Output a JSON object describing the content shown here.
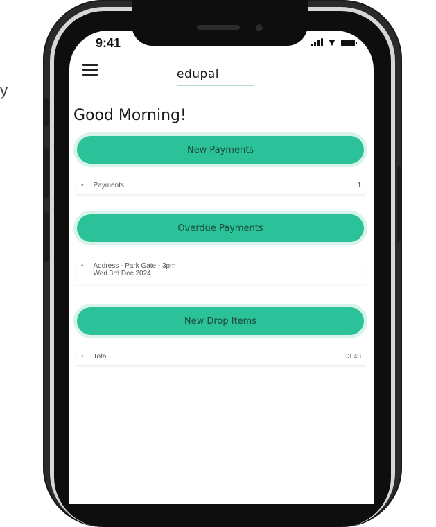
{
  "edge_fragment": "y",
  "status_bar": {
    "time": "9:41",
    "signal_icon": "signal-icon",
    "wifi_icon": "wifi-icon",
    "battery_icon": "battery-icon"
  },
  "header": {
    "menu_icon": "hamburger-menu-icon",
    "logo": "edupal"
  },
  "greeting": "Good Morning!",
  "sections": [
    {
      "button_label": "New Payments",
      "rows": [
        {
          "text": "Payments",
          "value": "1"
        }
      ]
    },
    {
      "button_label": "Overdue Payments",
      "rows": [
        {
          "line1": "Address - Park Gate - 3pm",
          "line2": "Wed 3rd Dec 2024",
          "value": ""
        }
      ]
    },
    {
      "button_label": "New Drop Items",
      "rows": [
        {
          "text": "Total",
          "value": "£3.48"
        }
      ]
    }
  ],
  "colors": {
    "accent": "#2bc29a",
    "accent_glow": "#d8f3ea",
    "button_text": "#1b4a3d"
  }
}
